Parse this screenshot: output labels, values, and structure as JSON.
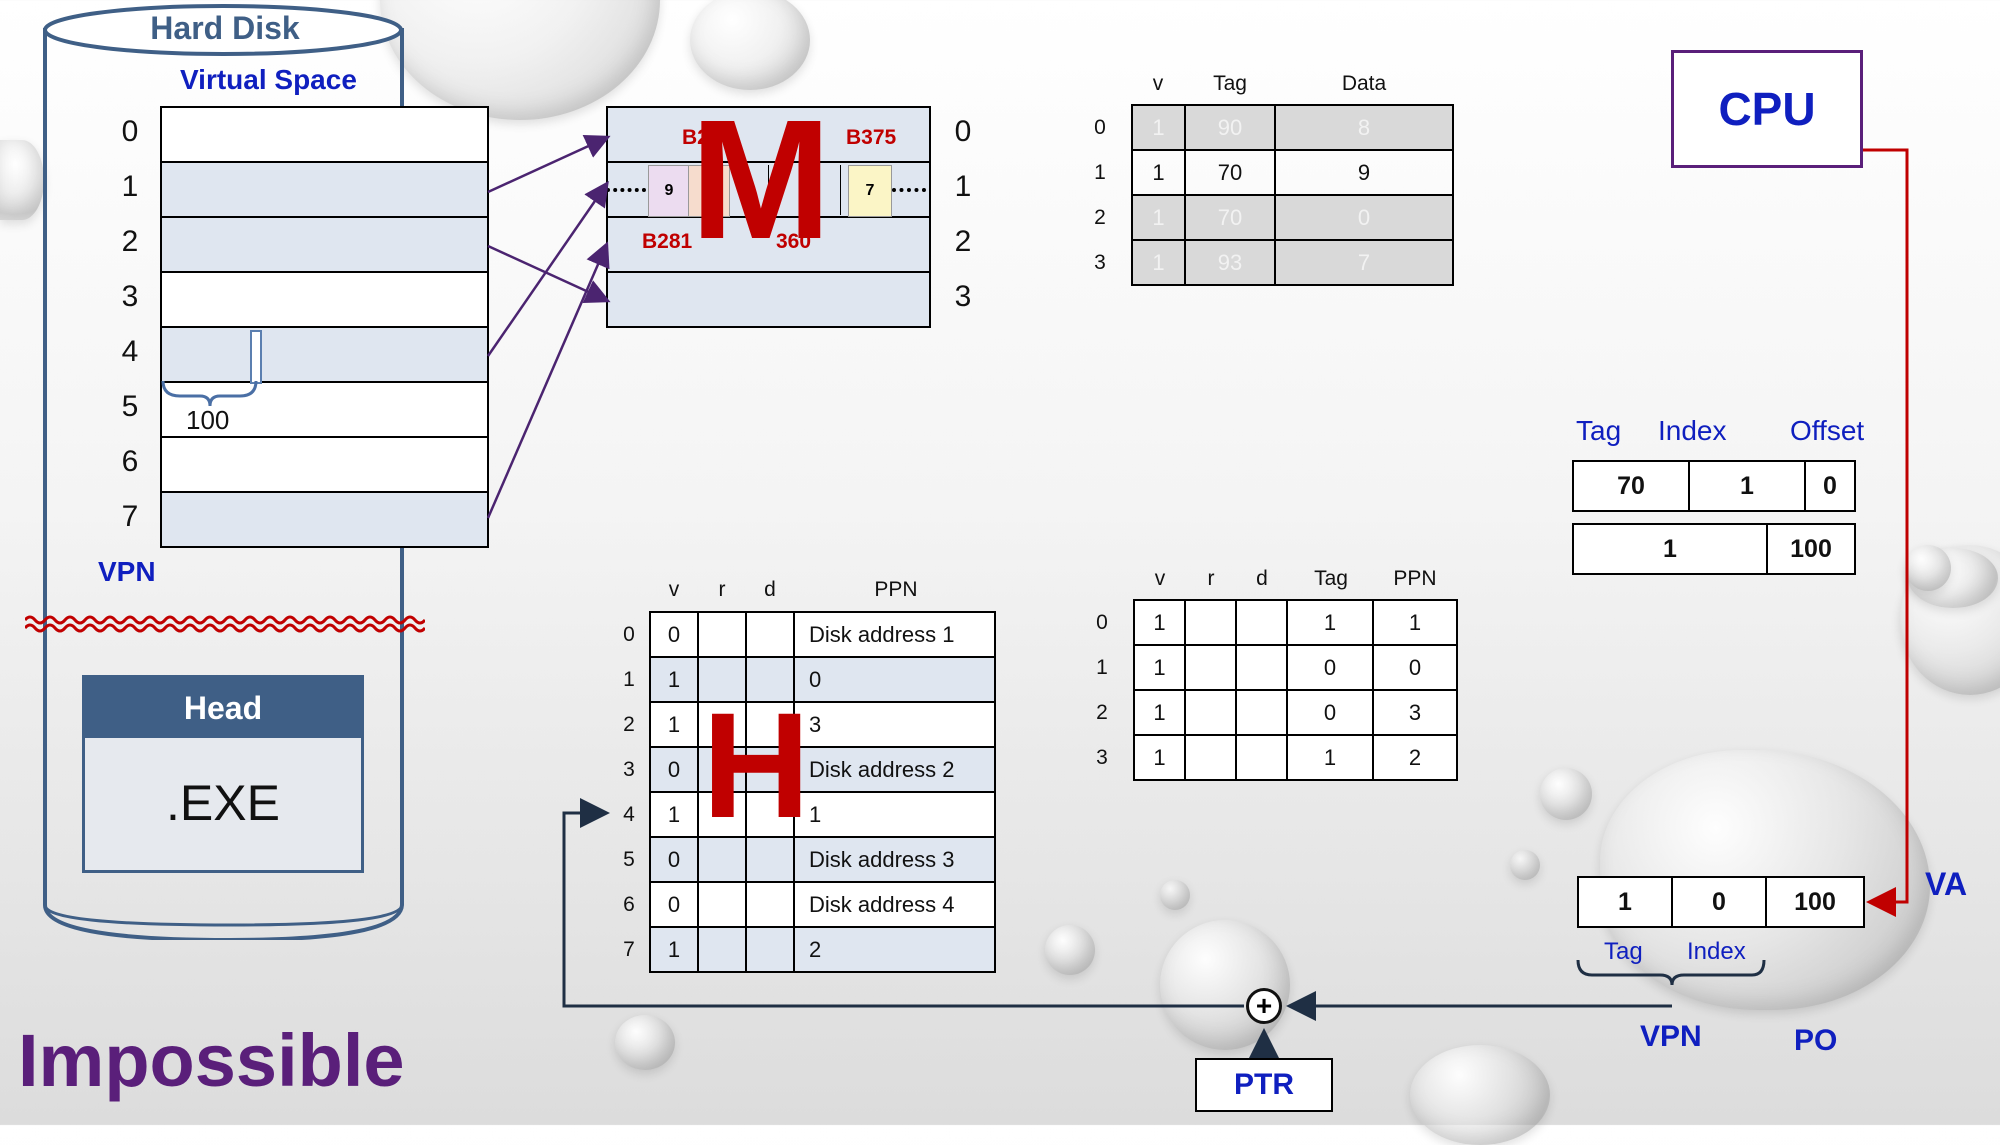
{
  "hard_disk": {
    "title": "Hard Disk",
    "virtual_space_label": "Virtual Space",
    "rows": [
      "0",
      "1",
      "2",
      "3",
      "4",
      "5",
      "6",
      "7"
    ],
    "offset_value": "100",
    "vpn_label": "VPN",
    "head_label": "Head",
    "exe_label": ".EXE"
  },
  "memory": {
    "big_letter": "M",
    "rows": [
      "0",
      "1",
      "2",
      "3"
    ],
    "block_labels": [
      "B28",
      "B375",
      "B281",
      "360"
    ],
    "row1_cells": [
      "9",
      "0",
      "7"
    ]
  },
  "cache_table": {
    "headers": [
      "v",
      "Tag",
      "Data"
    ],
    "rows": [
      {
        "index": "0",
        "v": "1",
        "tag": "90",
        "data": "8",
        "grayed": true
      },
      {
        "index": "1",
        "v": "1",
        "tag": "70",
        "data": "9",
        "grayed": false
      },
      {
        "index": "2",
        "v": "1",
        "tag": "70",
        "data": "0",
        "grayed": true
      },
      {
        "index": "3",
        "v": "1",
        "tag": "93",
        "data": "7",
        "grayed": true
      }
    ]
  },
  "cpu_label": "CPU",
  "address_breakdown": {
    "headers": [
      "Tag",
      "Index",
      "Offset"
    ],
    "row1": [
      "70",
      "1",
      "0"
    ],
    "row2": [
      "1",
      "100"
    ]
  },
  "page_table": {
    "headers": [
      "v",
      "r",
      "d",
      "PPN"
    ],
    "big_letter": "H",
    "rows": [
      {
        "index": "0",
        "v": "0",
        "ppn": "Disk address 1"
      },
      {
        "index": "1",
        "v": "1",
        "ppn": "0"
      },
      {
        "index": "2",
        "v": "1",
        "ppn": "3"
      },
      {
        "index": "3",
        "v": "0",
        "ppn": "Disk address 2"
      },
      {
        "index": "4",
        "v": "1",
        "ppn": "1"
      },
      {
        "index": "5",
        "v": "0",
        "ppn": "Disk address 3"
      },
      {
        "index": "6",
        "v": "0",
        "ppn": "Disk address 4"
      },
      {
        "index": "7",
        "v": "1",
        "ppn": "2"
      }
    ]
  },
  "tlb_table": {
    "headers": [
      "v",
      "r",
      "d",
      "Tag",
      "PPN"
    ],
    "rows": [
      {
        "index": "0",
        "v": "1",
        "tag": "1",
        "ppn": "1"
      },
      {
        "index": "1",
        "v": "1",
        "tag": "0",
        "ppn": "0"
      },
      {
        "index": "2",
        "v": "1",
        "tag": "0",
        "ppn": "3"
      },
      {
        "index": "3",
        "v": "1",
        "tag": "1",
        "ppn": "2"
      }
    ]
  },
  "virtual_address": {
    "values": [
      "1",
      "0",
      "100"
    ],
    "va_label": "VA",
    "tag_label": "Tag",
    "index_label": "Index",
    "vpn_label": "VPN",
    "po_label": "PO"
  },
  "ptr_label": "PTR",
  "adder_symbol": "+",
  "impossible_label": "Impossible",
  "colors": {
    "accent_blue": "#0f1fbf",
    "dark_red": "#b01010",
    "purple": "#5a1f7a",
    "slate": "#3f5f86",
    "memory_label_red": "#c00000"
  }
}
